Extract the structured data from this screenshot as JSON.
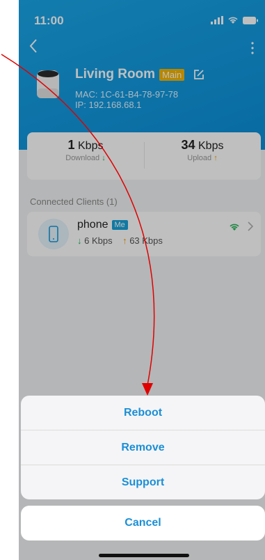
{
  "status_bar": {
    "time": "11:00"
  },
  "device": {
    "name": "Living Room",
    "badge": "Main",
    "mac": "MAC: 1C-61-B4-78-97-78",
    "ip": "IP: 192.168.68.1"
  },
  "stats": {
    "download": {
      "value": "1",
      "unit": "Kbps",
      "label": "Download",
      "arrow": "↓"
    },
    "upload": {
      "value": "34",
      "unit": "Kbps",
      "label": "Upload",
      "arrow": "↑"
    }
  },
  "clients": {
    "section_title": "Connected Clients (1)",
    "items": [
      {
        "name": "phone",
        "badge": "Me",
        "down_arrow": "↓",
        "down": "6 Kbps",
        "up_arrow": "↑",
        "up": "63 Kbps"
      }
    ]
  },
  "action_sheet": {
    "items": [
      "Reboot",
      "Remove",
      "Support"
    ],
    "cancel": "Cancel"
  },
  "colors": {
    "header": "#0b8fd8",
    "accent": "#1b8fd6",
    "main_badge": "#f4b400",
    "annotation": "#e00000"
  }
}
